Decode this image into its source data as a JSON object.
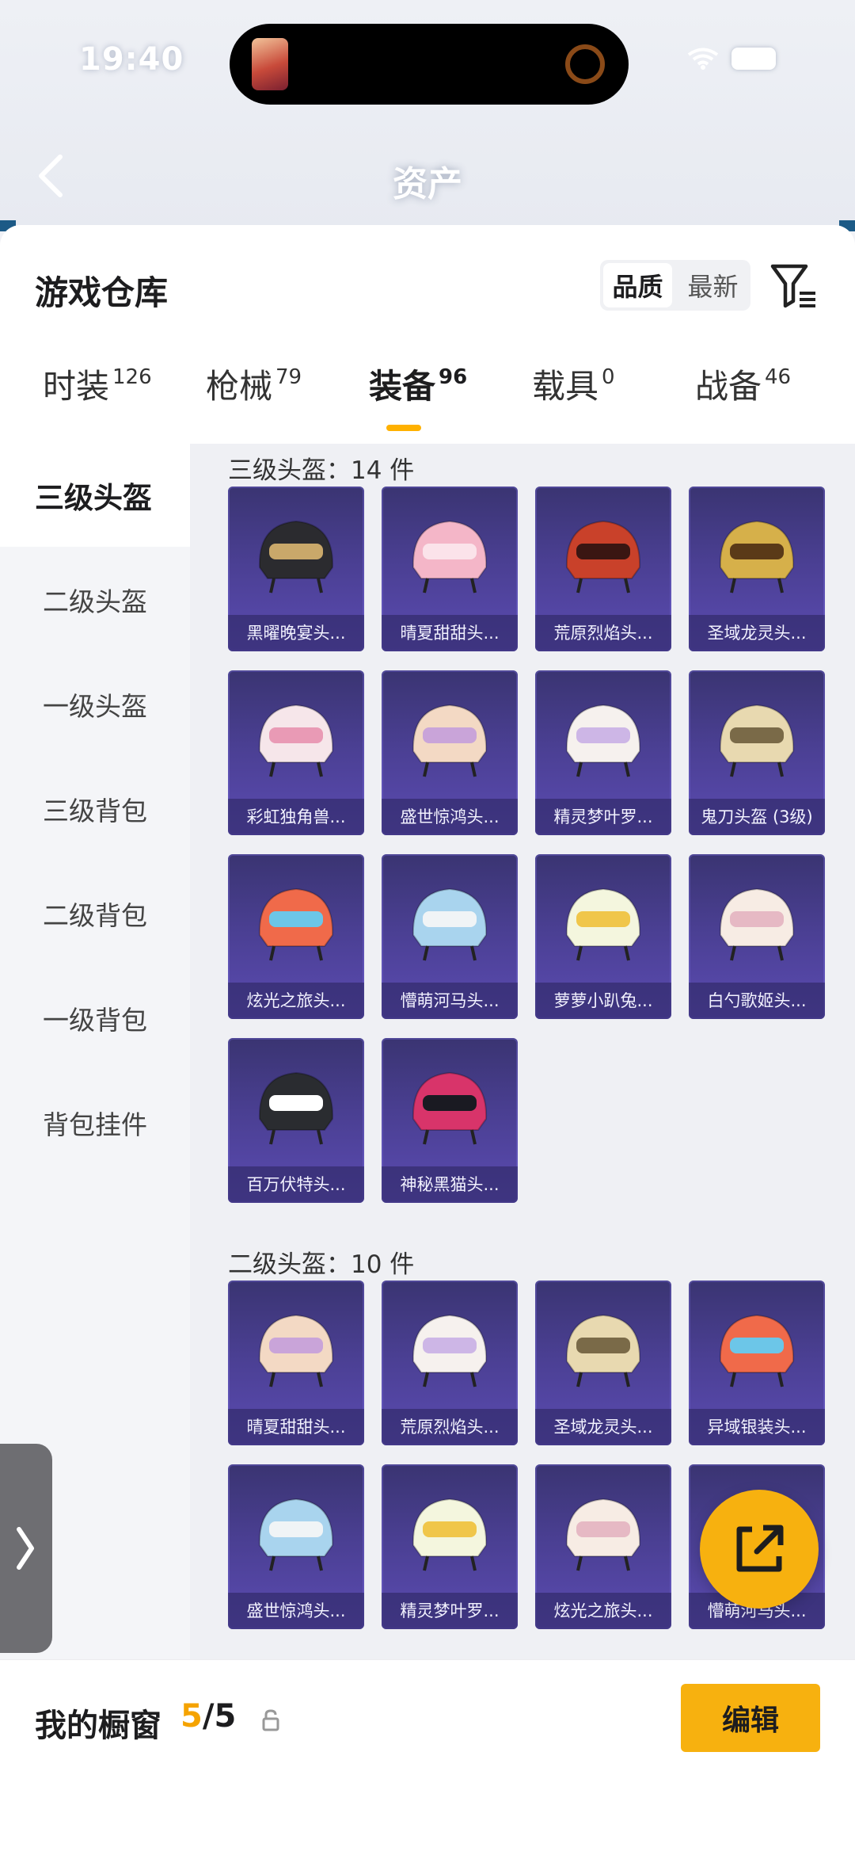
{
  "status": {
    "time": "19:40"
  },
  "nav": {
    "title": "资产"
  },
  "sheet": {
    "title": "游戏仓库",
    "sort": [
      "品质",
      "最新"
    ]
  },
  "tabs": [
    {
      "label": "时装",
      "count": "126"
    },
    {
      "label": "枪械",
      "count": "79"
    },
    {
      "label": "装备",
      "count": "96"
    },
    {
      "label": "载具",
      "count": "0"
    },
    {
      "label": "战备",
      "count": "46"
    }
  ],
  "sidebar": [
    "三级头盔",
    "二级头盔",
    "一级头盔",
    "三级背包",
    "二级背包",
    "一级背包",
    "背包挂件"
  ],
  "sections": [
    {
      "title": "三级头盔：14 件",
      "items": [
        "黑曜晚宴头...",
        "晴夏甜甜头...",
        "荒原烈焰头...",
        "圣域龙灵头...",
        "彩虹独角兽...",
        "盛世惊鸿头...",
        "精灵梦叶罗...",
        "鬼刀头盔 (3级)",
        "炫光之旅头...",
        "懵萌河马头...",
        "萝萝小趴兔...",
        "白勺歌姬头...",
        "百万伏特头...",
        "神秘黑猫头..."
      ]
    },
    {
      "title": "二级头盔：10 件",
      "items": [
        "晴夏甜甜头...",
        "荒原烈焰头...",
        "圣域龙灵头...",
        "异域银装头...",
        "盛世惊鸿头...",
        "精灵梦叶罗...",
        "炫光之旅头...",
        "懵萌河马头..."
      ]
    }
  ],
  "bottom": {
    "title": "我的橱窗",
    "count_current": "5",
    "count_total": "/5",
    "edit_label": "编辑"
  },
  "colors": {
    "accent": "#f7b10f",
    "card_top": "#3a3472",
    "card_bottom": "#5b4bb2"
  },
  "icons": [
    "back-icon",
    "wifi-icon",
    "battery-icon",
    "filter-icon",
    "lock-icon",
    "share-icon",
    "chevron-right-icon"
  ]
}
